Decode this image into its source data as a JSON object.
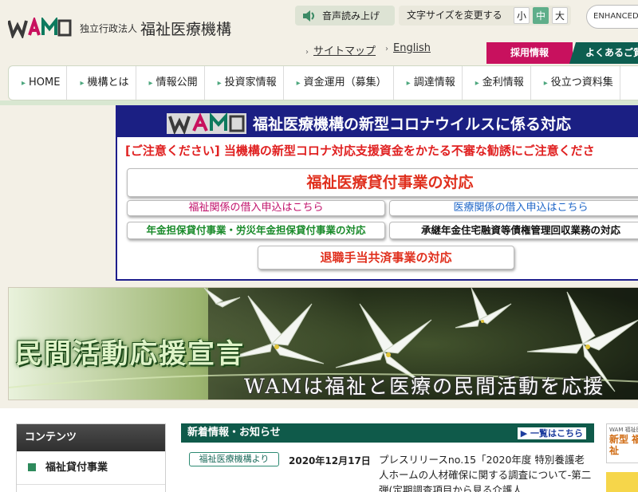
{
  "header": {
    "logo_text": "WAM",
    "org_prefix": "独立行政法人",
    "org_name": "福祉医療機構",
    "voice_label": "音声読み上げ",
    "textsize_label": "文字サイズを変更する",
    "textsize_options": [
      "小",
      "中",
      "大"
    ],
    "textsize_selected": "中",
    "enhanced_label": "ENHANCED",
    "sitemap_label": "サイトマップ",
    "english_label": "English",
    "recruit_label": "採用情報",
    "faq_label": "よくあるご質"
  },
  "nav": {
    "items": [
      "HOME",
      "機構とは",
      "情報公開",
      "投資家情報",
      "資金運用（募集）",
      "調達情報",
      "金利情報",
      "役立つ資料集"
    ]
  },
  "corona": {
    "logo_text": "WAM",
    "title": "福祉医療機構の新型コロナウイルスに係る対応",
    "warning": "[ご注意ください] 当機構の新型コロナ対応支援資金をかたる不審な勧誘にご注意くださ",
    "btn_welfare": "福祉医療貸付事業の対応",
    "btn_fukushi": "福祉関係の借入申込はこちら",
    "btn_iryo": "医療関係の借入申込はこちら",
    "btn_nenkin": "年金担保貸付事業・労災年金担保貸付事業の対応",
    "btn_shokei": "承継年金住宅融資等債権管理回収業務の対応",
    "btn_taishoku": "退職手当共済事業の対応"
  },
  "banner": {
    "title": "民間活動応援宣言",
    "subtitle": "WAMは福祉と医療の民間活動を応援"
  },
  "sidebar": {
    "heading": "コンテンツ",
    "items": [
      "福祉貸付事業"
    ]
  },
  "news": {
    "heading": "新着情報・お知らせ",
    "more_label": "▶ 一覧はこちら",
    "items": [
      {
        "tag": "福祉医療機構より",
        "date": "2020年12月17日",
        "text": "プレスリリースno.15「2020年度 特別養護老人ホームの人材確保に関する調査について‐第二弾(定期調査項目から見る介護人"
      }
    ]
  },
  "right_ad": {
    "small": "WAM 福祉医",
    "title": "新型 福祉"
  },
  "colors": {
    "accent_green": "#0f5a4a",
    "recruit_pink": "#c8115e",
    "corona_navy": "#1b1f83",
    "warning_red": "#e02020"
  }
}
